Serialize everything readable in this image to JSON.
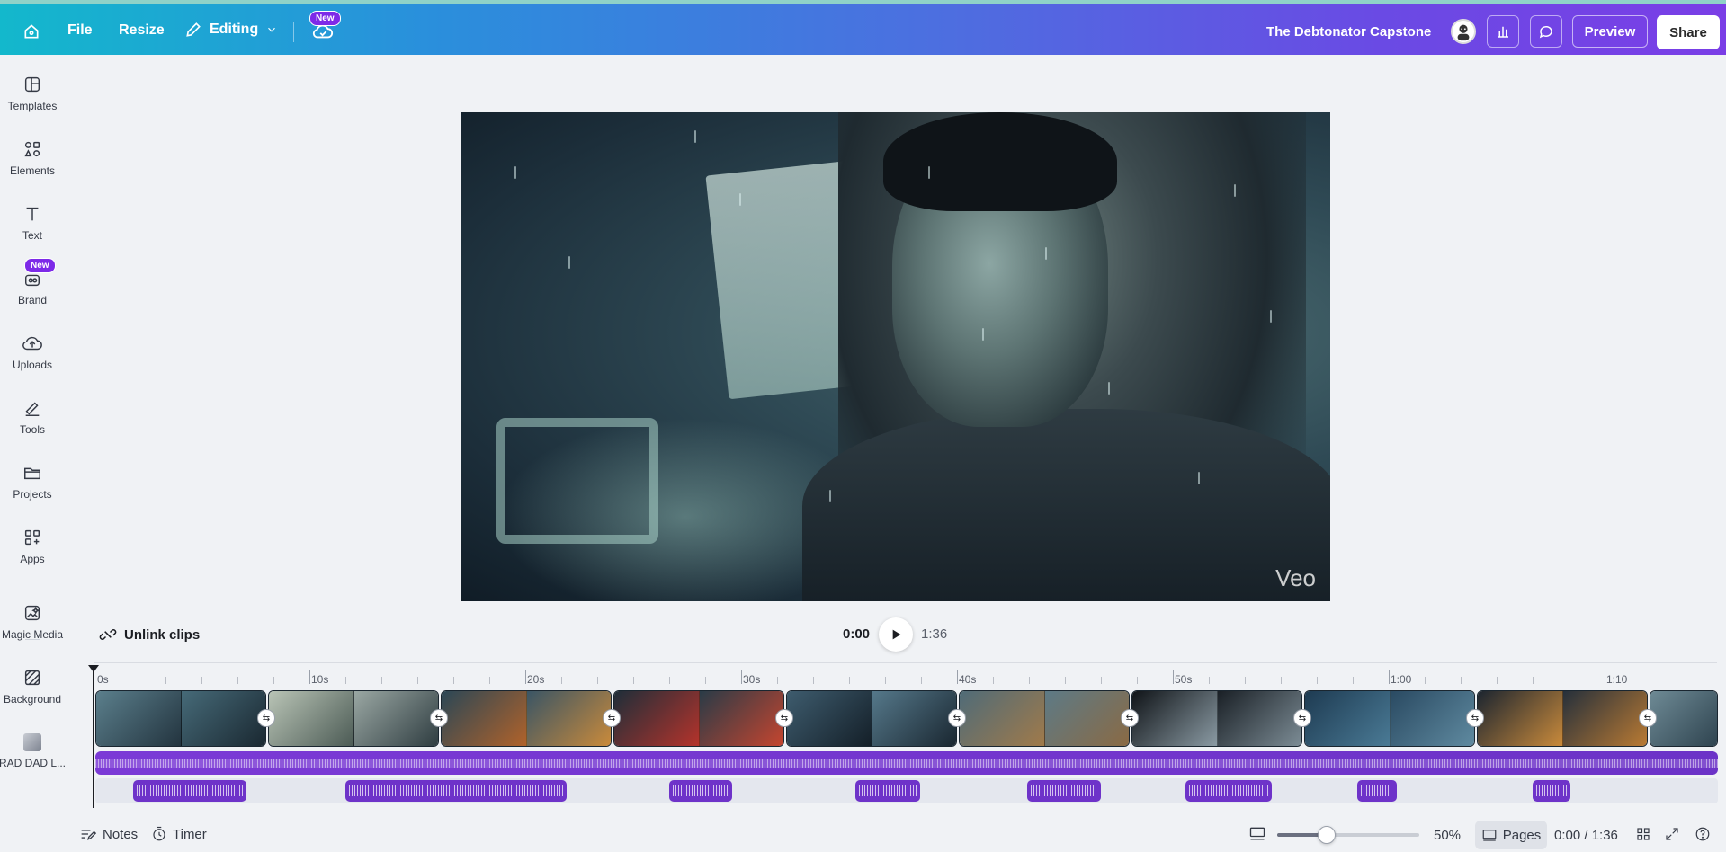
{
  "topbar": {
    "file_label": "File",
    "resize_label": "Resize",
    "editing_label": "Editing",
    "new_badge": "New",
    "doc_title": "The Debtonator Capstone",
    "preview_label": "Preview",
    "share_label": "Share"
  },
  "sidebar": {
    "items": [
      {
        "label": "Templates",
        "icon": "templates-icon"
      },
      {
        "label": "Elements",
        "icon": "elements-icon"
      },
      {
        "label": "Text",
        "icon": "text-icon"
      },
      {
        "label": "Brand",
        "icon": "brand-icon",
        "badge": "New"
      },
      {
        "label": "Uploads",
        "icon": "uploads-icon"
      },
      {
        "label": "Tools",
        "icon": "tools-icon"
      },
      {
        "label": "Projects",
        "icon": "projects-icon"
      },
      {
        "label": "Apps",
        "icon": "apps-icon"
      },
      {
        "label": "Magic Media",
        "icon": "magic-media-icon"
      },
      {
        "label": "Background",
        "icon": "background-icon"
      },
      {
        "label": "RAD DAD L...",
        "icon": "rad-dad-thumbnail"
      }
    ]
  },
  "canvas": {
    "watermark": "Veo"
  },
  "playback": {
    "unlink_label": "Unlink clips",
    "current_time": "0:00",
    "total_time": "1:36"
  },
  "timeline": {
    "ruler_labels": [
      "0s",
      "10s",
      "20s",
      "30s",
      "40s",
      "50s",
      "1:00",
      "1:10"
    ],
    "clip_count": 10
  },
  "bottombar": {
    "notes_label": "Notes",
    "timer_label": "Timer",
    "zoom_percent": 50,
    "zoom_label": "50%",
    "pages_label": "Pages",
    "page_time": "0:00 / 1:36"
  },
  "colors": {
    "accent": "#7d2ae8",
    "audio_track": "#7b3ad6",
    "topbar_start": "#13b8cc",
    "topbar_end": "#7a3ee6"
  }
}
